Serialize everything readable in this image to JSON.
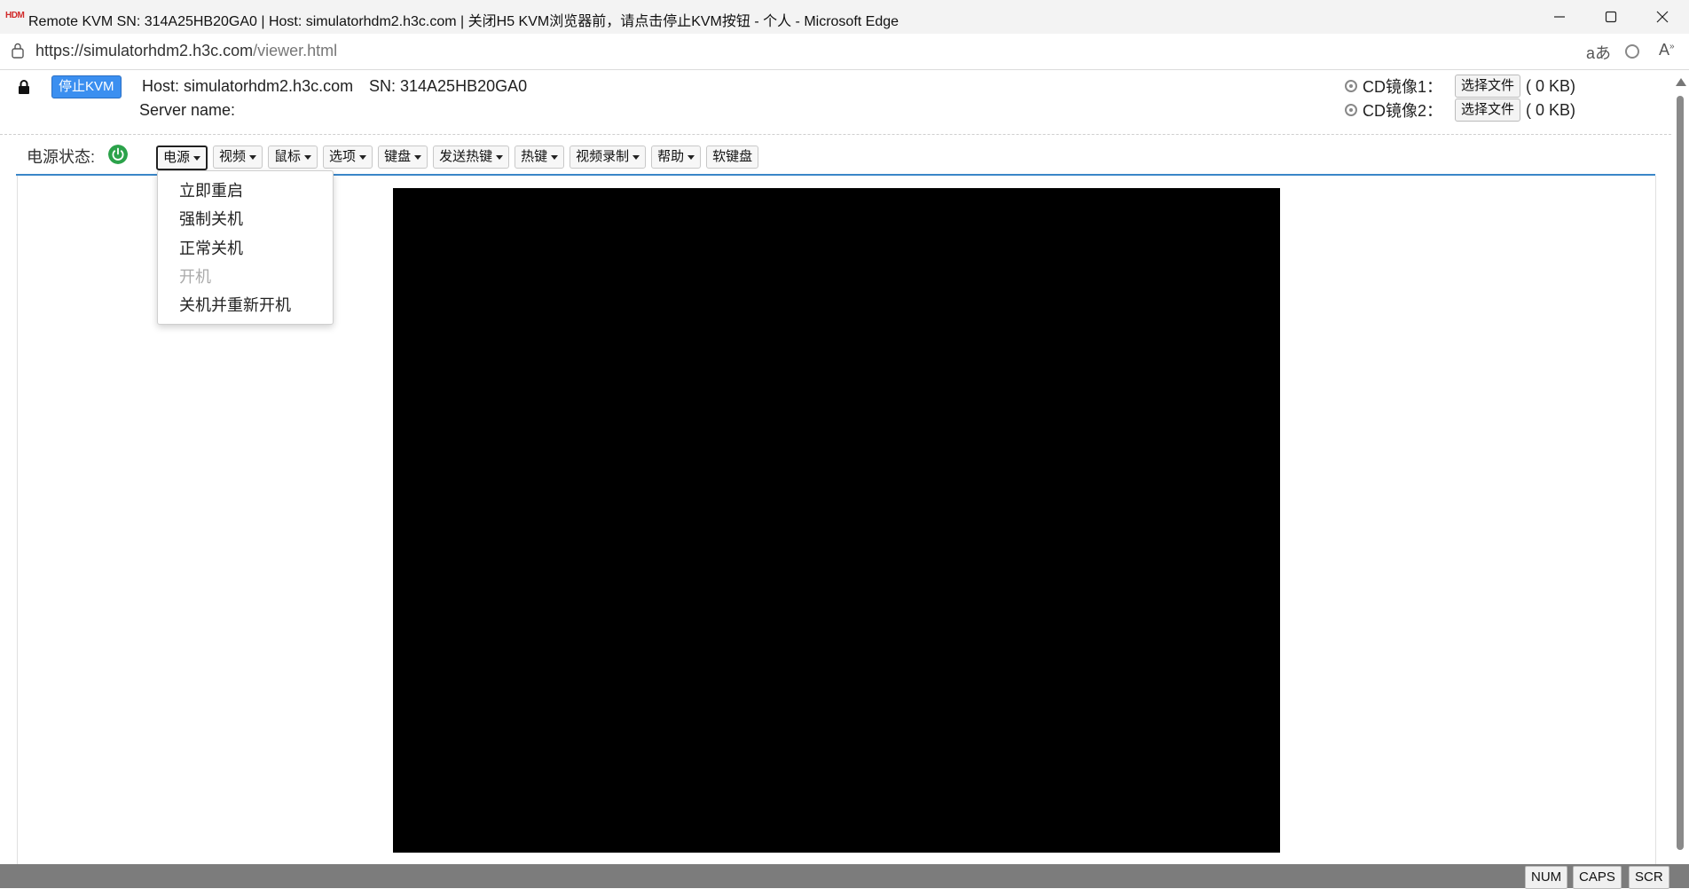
{
  "window": {
    "logo_text": "HDM",
    "title": "Remote KVM SN: 314A25HB20GA0 | Host: simulatorhdm2.h3c.com | 关闭H5 KVM浏览器前，请点击停止KVM按钮 - 个人 - Microsoft Edge"
  },
  "address_bar": {
    "url_host": "https://simulatorhdm2.h3c.com",
    "url_path": "/viewer.html"
  },
  "kvm_header": {
    "stop_button": "停止KVM",
    "host": "Host: simulatorhdm2.h3c.com",
    "sn": "SN: 314A25HB20GA0",
    "server_name": "Server name:",
    "cd_images": [
      {
        "label": "CD镜像1：",
        "button": "选择文件",
        "size": "( 0 KB)"
      },
      {
        "label": "CD镜像2：",
        "button": "选择文件",
        "size": "( 0 KB)"
      }
    ]
  },
  "power_status_label": "电源状态:",
  "toolbar": {
    "items": [
      {
        "label": "电源",
        "dropdown": true,
        "active": true
      },
      {
        "label": "视频",
        "dropdown": true
      },
      {
        "label": "鼠标",
        "dropdown": true
      },
      {
        "label": "选项",
        "dropdown": true
      },
      {
        "label": "键盘",
        "dropdown": true
      },
      {
        "label": "发送热键",
        "dropdown": true
      },
      {
        "label": "热键",
        "dropdown": true
      },
      {
        "label": "视频录制",
        "dropdown": true
      },
      {
        "label": "帮助",
        "dropdown": true
      },
      {
        "label": "软键盘",
        "dropdown": false
      }
    ]
  },
  "power_menu": {
    "items": [
      {
        "label": "立即重启",
        "enabled": true
      },
      {
        "label": "强制关机",
        "enabled": true
      },
      {
        "label": "正常关机",
        "enabled": true
      },
      {
        "label": "开机",
        "enabled": false
      },
      {
        "label": "关机并重新开机",
        "enabled": true
      }
    ]
  },
  "status_bar": {
    "num": "NUM",
    "caps": "CAPS",
    "scr": "SCR"
  },
  "colors": {
    "stop_button": "#3b8ff0",
    "power_on": "#2ba24a",
    "divider": "#3a86c8",
    "status_bar": "#7c7c7c"
  },
  "icons": {
    "app_logo": "h3c-hdm-logo",
    "lock": "padlock-icon",
    "power": "power-icon",
    "cd": "cd-disc-icon"
  }
}
